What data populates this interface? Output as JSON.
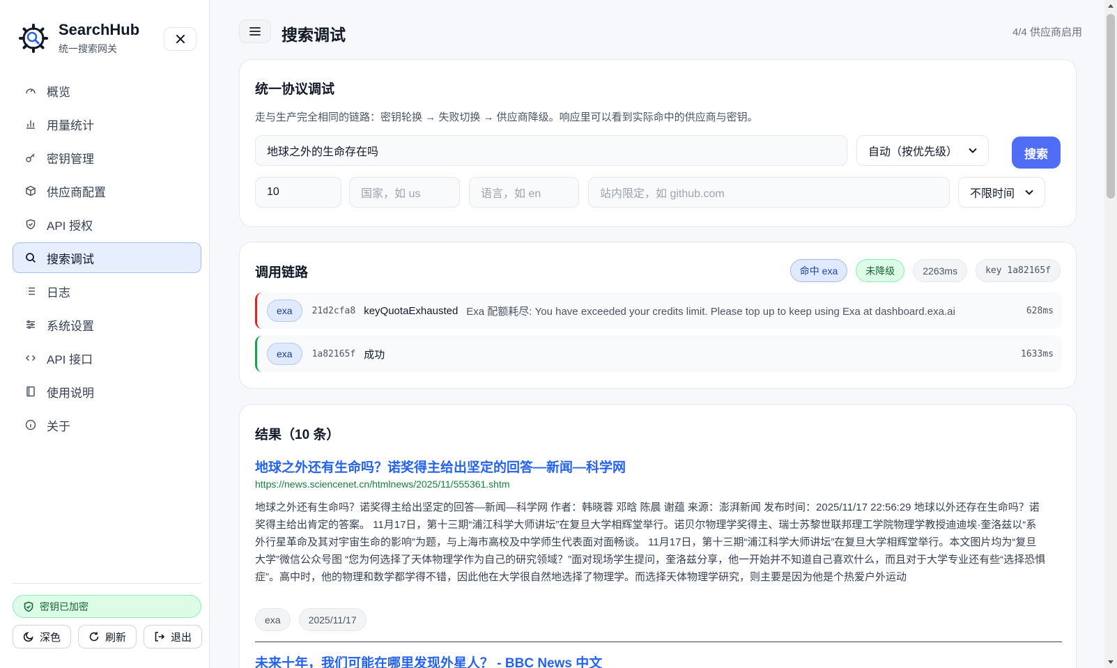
{
  "brand": {
    "title": "SearchHub",
    "subtitle": "统一搜索网关"
  },
  "sidebar": {
    "items": [
      {
        "label": "概览",
        "icon": "gauge-icon"
      },
      {
        "label": "用量统计",
        "icon": "bar-chart-icon"
      },
      {
        "label": "密钥管理",
        "icon": "key-icon"
      },
      {
        "label": "供应商配置",
        "icon": "box-icon"
      },
      {
        "label": "API 授权",
        "icon": "shield-icon"
      },
      {
        "label": "搜索调试",
        "icon": "search-icon"
      },
      {
        "label": "日志",
        "icon": "list-icon"
      },
      {
        "label": "系统设置",
        "icon": "sliders-icon"
      },
      {
        "label": "API 接口",
        "icon": "code-icon"
      },
      {
        "label": "使用说明",
        "icon": "book-icon"
      },
      {
        "label": "关于",
        "icon": "info-icon"
      }
    ],
    "active_index": 5,
    "secure_badge": "密钥已加密",
    "buttons": {
      "theme": "深色",
      "refresh": "刷新",
      "logout": "退出"
    }
  },
  "header": {
    "title": "搜索调试",
    "provider_status": "4/4  供应商启用"
  },
  "debug": {
    "title": "统一协议调试",
    "description": "走与生产完全相同的链路：密钥轮换 → 失败切换 → 供应商降级。响应里可以看到实际命中的供应商与密钥。",
    "query": "地球之外的生命存在吗",
    "provider_select": "自动（按优先级）",
    "search_button": "搜索",
    "count": "10",
    "country_placeholder": "国家，如 us",
    "language_placeholder": "语言，如 en",
    "site_placeholder": "站内限定，如 github.com",
    "time_select": "不限时间"
  },
  "trace": {
    "title": "调用链路",
    "chips": {
      "hit": "命中 exa",
      "degrade": "未降级",
      "latency": "2263ms",
      "key": "key 1a82165f"
    },
    "rows": [
      {
        "provider": "exa",
        "key": "21d2cfa8",
        "code": "keyQuotaExhausted",
        "message": "Exa 配额耗尽: You have exceeded your credits limit. Please top up to keep using Exa at dashboard.exa.ai",
        "time": "628ms"
      },
      {
        "provider": "exa",
        "key": "1a82165f",
        "code": "成功",
        "message": "",
        "time": "1633ms"
      }
    ]
  },
  "results": {
    "title": "结果（10 条）",
    "items": [
      {
        "title": "地球之外还有生命吗？诺奖得主给出坚定的回答—新闻—科学网",
        "url": "https://news.sciencenet.cn/htmlnews/2025/11/555361.shtm",
        "snippet": "地球之外还有生命吗？诺奖得主给出坚定的回答—新闻—科学网 作者：韩晓蓉 邓晗 陈晨 谢蕴 来源：澎湃新闻 发布时间：2025/11/17 22:56:29 地球以外还存在生命吗？诺奖得主给出肯定的答案。 11月17日，第十三期“浦江科学大师讲坛”在复旦大学相辉堂举行。诺贝尔物理学奖得主、瑞士苏黎世联邦理工学院物理学教授迪迪埃·奎洛兹以“系外行星革命及其对宇宙生命的影响”为题，与上海市高校及中学师生代表面对面畅谈。 11月17日，第十三期“浦江科学大师讲坛”在复旦大学相辉堂举行。本文图片均为“复旦大学”微信公众号图 “您为何选择了天体物理学作为自己的研究领域？”面对现场学生提问，奎洛兹分享，他一开始并不知道自己喜欢什么，而且对于大学专业还有些“选择恐惧症”。高中时，他的物理和数学都学得不错，因此他在大学很自然地选择了物理学。而选择天体物理学研究，则主要是因为他是个热爱户外运动",
        "source": "exa",
        "date": "2025/11/17"
      },
      {
        "title": "未来十年，我们可能在哪里发现外星人？ - BBC News 中文"
      }
    ]
  },
  "colors": {
    "accent": "#4f6df5",
    "link": "#2563eb",
    "url": "#15803d",
    "error": "#dc2626",
    "success": "#16a34a"
  }
}
